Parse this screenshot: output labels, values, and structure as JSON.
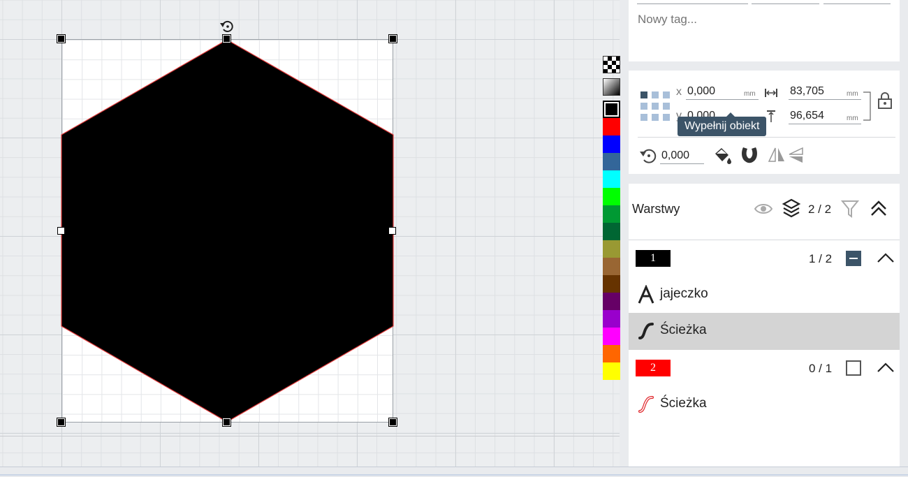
{
  "tags": {
    "new_tag_placeholder": "Nowy tag..."
  },
  "transform": {
    "x_label": "x",
    "x_value": "0,000",
    "y_label": "y",
    "y_value": "0,000",
    "width_value": "83,705",
    "height_value": "96,654",
    "unit": "mm",
    "rotation_value": "0,000",
    "tooltip": "Wypełnij obiekt"
  },
  "palette": {
    "colors": [
      "#ff0000",
      "#0000ff",
      "#336699",
      "#00ffff",
      "#00ff00",
      "#009933",
      "#006633",
      "#999933",
      "#996633",
      "#663300",
      "#660066",
      "#9900cc",
      "#ff00ff",
      "#ff6600",
      "#ffff00"
    ]
  },
  "layers_panel": {
    "title": "Warstwy",
    "count": "2 / 2",
    "layers": [
      {
        "number": "1",
        "color": "#000000",
        "count": "1 / 2",
        "objects": [
          {
            "label": "jajeczko",
            "icon": "text-icon",
            "selected": false
          },
          {
            "label": "Ścieżka",
            "icon": "path-icon",
            "selected": true
          }
        ]
      },
      {
        "number": "2",
        "color": "#ff0000",
        "count": "0 / 1",
        "objects": [
          {
            "label": "Ścieżka",
            "icon": "path-outline-icon",
            "selected": false
          }
        ]
      }
    ]
  }
}
